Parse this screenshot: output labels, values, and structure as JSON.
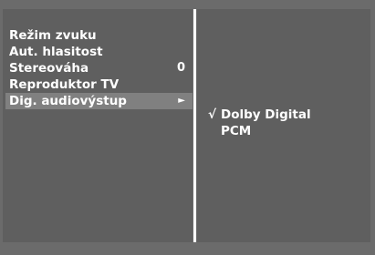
{
  "menu": {
    "items": [
      {
        "label": "Režim zvuku",
        "value": ""
      },
      {
        "label": "Aut. hlasitost",
        "value": ""
      },
      {
        "label": "Stereováha",
        "value": "0"
      },
      {
        "label": "Reproduktor TV",
        "value": ""
      },
      {
        "label": "Dig. audiovýstup",
        "value": "",
        "arrow": "►",
        "selected": true
      }
    ]
  },
  "submenu": {
    "items": [
      {
        "check": "√",
        "label": "Dolby Digital",
        "checked": true
      },
      {
        "check": "",
        "label": "PCM",
        "checked": false
      }
    ]
  },
  "colors": {
    "background": "#6b6b6b",
    "panel": "#5f5f5f",
    "highlight": "#808080",
    "text": "#ffffff"
  }
}
